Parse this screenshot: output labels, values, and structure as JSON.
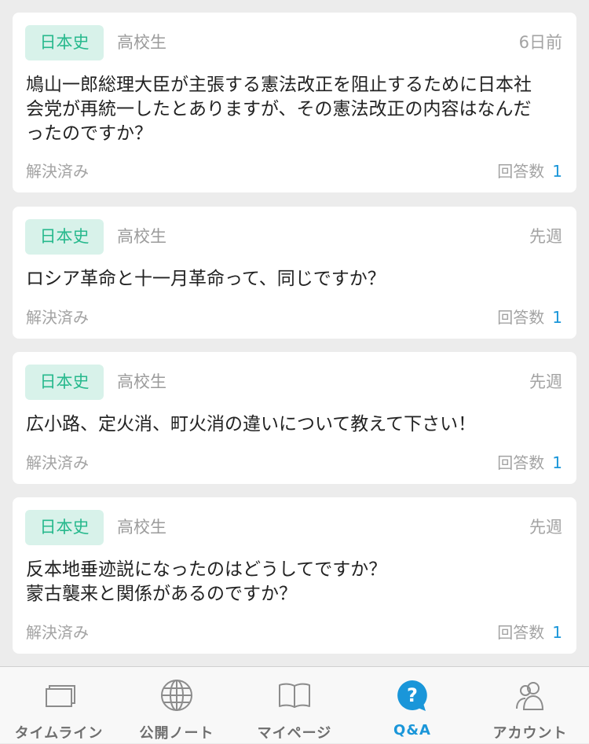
{
  "questions": [
    {
      "tag": "日本史",
      "grade": "高校生",
      "time": "6日前",
      "text": "鳩山一郎総理大臣が主張する憲法改正を阻止するために日本社\n会党が再統一したとありますが、その憲法改正の内容はなんだ\nったのですか？",
      "status": "解決済み",
      "answers_label": "回答数",
      "answers_count": "1"
    },
    {
      "tag": "日本史",
      "grade": "高校生",
      "time": "先週",
      "text": "ロシア革命と十一月革命って、同じですか？",
      "status": "解決済み",
      "answers_label": "回答数",
      "answers_count": "1"
    },
    {
      "tag": "日本史",
      "grade": "高校生",
      "time": "先週",
      "text": "広小路、定火消、町火消の違いについて教えて下さい！",
      "status": "解決済み",
      "answers_label": "回答数",
      "answers_count": "1"
    },
    {
      "tag": "日本史",
      "grade": "高校生",
      "time": "先週",
      "text": "反本地垂迹説になったのはどうしてですか？\n蒙古襲来と関係があるのですか？",
      "status": "解決済み",
      "answers_label": "回答数",
      "answers_count": "1"
    }
  ],
  "tabs": [
    {
      "label": "タイムライン",
      "icon": "timeline-icon"
    },
    {
      "label": "公開ノート",
      "icon": "globe-icon"
    },
    {
      "label": "マイページ",
      "icon": "book-icon"
    },
    {
      "label": "Q&A",
      "icon": "question-bubble-icon",
      "active": true
    },
    {
      "label": "アカウント",
      "icon": "account-icon"
    }
  ],
  "colors": {
    "accent": "#1a96d9",
    "tag_bg": "#d8f2ea",
    "tag_text": "#27b98d",
    "muted": "#a3a3a3",
    "background": "#ececec"
  }
}
